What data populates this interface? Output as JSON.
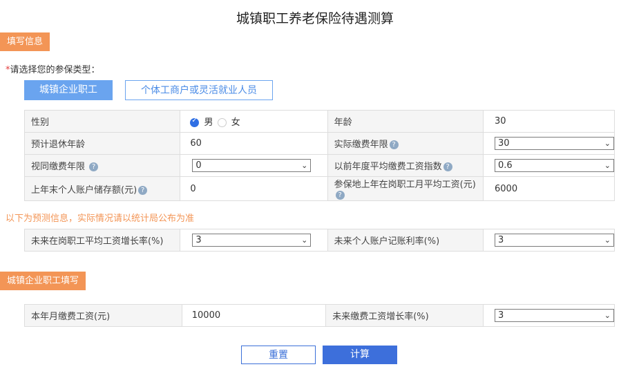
{
  "title": "城镇职工养老保险待遇测算",
  "section1": {
    "label": "填写信息"
  },
  "type_prompt": {
    "star": "*",
    "text": "请选择您的参保类型："
  },
  "type_options": {
    "active": "城镇企业职工",
    "inactive": "个体工商户或灵活就业人员"
  },
  "basic": {
    "gender_label": "性别",
    "gender_male": "男",
    "gender_female": "女",
    "age_label": "年龄",
    "age_value": "30",
    "retire_age_label": "预计退休年龄",
    "retire_age_value": "60",
    "actual_years_label": "实际缴费年限",
    "actual_years_value": "30",
    "deemed_years_label": "视同缴费年限",
    "deemed_years_value": "0",
    "prev_index_label": "以前年度平均缴费工资指数",
    "prev_index_value": "0.6",
    "account_label": "上年末个人账户储存额(元)",
    "account_value": "0",
    "avg_wage_label": "参保地上年在岗职工月平均工资(元)",
    "avg_wage_value": "6000"
  },
  "notice": "以下为预测信息，实际情况请以统计局公布为准",
  "forecast": {
    "wage_growth_label": "未来在岗职工平均工资增长率(%)",
    "wage_growth_value": "3",
    "interest_label": "未来个人账户记账利率(%)",
    "interest_value": "3"
  },
  "section2": {
    "label": "城镇企业职工填写"
  },
  "employee": {
    "monthly_wage_label": "本年月缴费工资(元)",
    "monthly_wage_value": "10000",
    "future_growth_label": "未来缴费工资增长率(%)",
    "future_growth_value": "3"
  },
  "buttons": {
    "reset": "重置",
    "calc": "计算"
  },
  "icons": {
    "help": "?",
    "chevron": "⌄"
  }
}
